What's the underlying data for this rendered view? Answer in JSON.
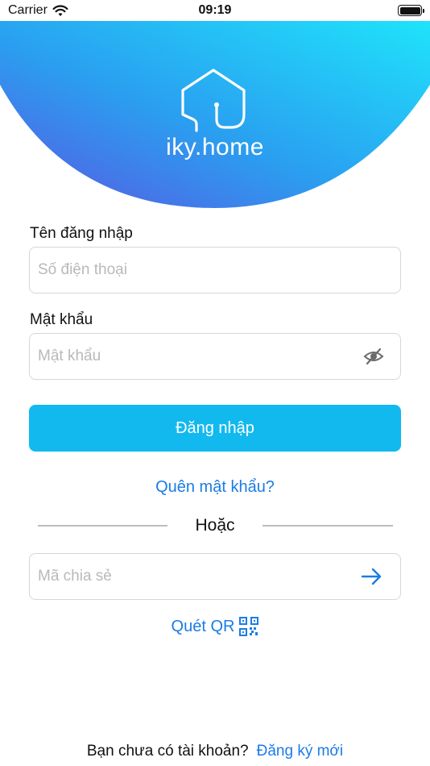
{
  "status_bar": {
    "carrier": "Carrier",
    "time": "09:19"
  },
  "brand": {
    "logo_text": "iky.home",
    "gradient_start": "#5a56e2",
    "gradient_end": "#1fe3fb"
  },
  "login_form": {
    "username_label": "Tên đăng nhập",
    "username_placeholder": "Số điện thoại",
    "username_value": "",
    "password_label": "Mật khẩu",
    "password_placeholder": "Mật khẩu",
    "password_value": "",
    "submit_label": "Đăng nhập",
    "forgot_password_label": "Quên mật khẩu?"
  },
  "divider": {
    "label": "Hoặc"
  },
  "share_code": {
    "placeholder": "Mã chia sẻ",
    "value": "",
    "scan_qr_label": "Quét QR"
  },
  "footer": {
    "prompt": "Bạn chưa có tài khoản?",
    "register_label": "Đăng ký mới"
  },
  "colors": {
    "accent": "#12b9ef",
    "link": "#1a7ce6"
  },
  "icons": {
    "password_toggle": "eye-slash-icon",
    "submit_code": "arrow-right-icon",
    "scan_qr": "qr-code-icon",
    "logo": "house-plug-icon",
    "signal": "wifi-icon",
    "battery": "battery-icon"
  }
}
